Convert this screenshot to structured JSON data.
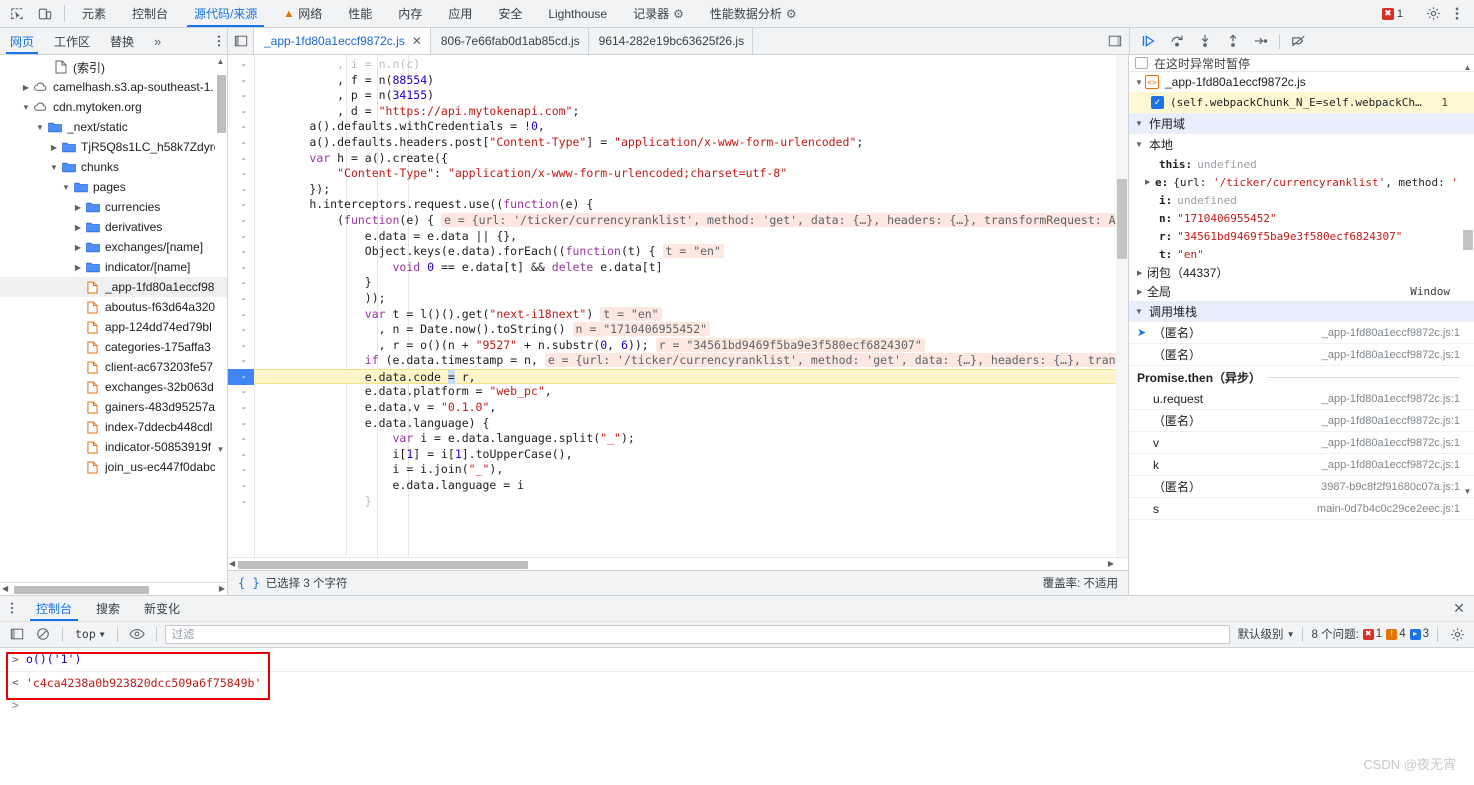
{
  "topbar": {
    "icons": [
      {
        "name": "inspect-element-icon"
      },
      {
        "name": "device-toolbar-icon"
      }
    ],
    "tabs": [
      {
        "label": "元素",
        "selected": false,
        "icon": null
      },
      {
        "label": "控制台",
        "selected": false,
        "icon": null
      },
      {
        "label": "源代码/来源",
        "selected": true,
        "icon": null
      },
      {
        "label": "网络",
        "selected": false,
        "icon": "warning-triangle-icon"
      },
      {
        "label": "性能",
        "selected": false,
        "icon": null
      },
      {
        "label": "内存",
        "selected": false,
        "icon": null
      },
      {
        "label": "应用",
        "selected": false,
        "icon": null
      },
      {
        "label": "安全",
        "selected": false,
        "icon": null
      },
      {
        "label": "Lighthouse",
        "selected": false,
        "icon": null
      },
      {
        "label": "记录器",
        "selected": false,
        "icon": "flask-icon"
      },
      {
        "label": "性能数据分析",
        "selected": false,
        "icon": "flask-icon"
      }
    ],
    "error_count": "1",
    "settings_label": "设置",
    "menu_label": "更多选项"
  },
  "subbar": {
    "nav_tabs": [
      {
        "label": "网页",
        "selected": true
      },
      {
        "label": "工作区",
        "selected": false
      },
      {
        "label": "替换",
        "selected": false
      },
      {
        "label": "»",
        "selected": false
      }
    ],
    "file_tabs": [
      {
        "label": "_app-1fd80a1eccf9872c.js",
        "selected": true,
        "closable": true
      },
      {
        "label": "806-7e66fab0d1ab85cd.js",
        "selected": false,
        "closable": false
      },
      {
        "label": "9614-282e19bc63625f26.js",
        "selected": false,
        "closable": false
      }
    ],
    "debug_buttons": [
      {
        "name": "resume-script-button",
        "title": "恢复脚本执行"
      },
      {
        "name": "step-over-button",
        "title": "跳过下一个函数调用"
      },
      {
        "name": "step-into-button",
        "title": "单步调试进入下一个函数调用"
      },
      {
        "name": "step-out-button",
        "title": "单步调试跳出当前函数"
      },
      {
        "name": "step-button",
        "title": "单步调试"
      },
      {
        "name": "deactivate-breakpoints-button",
        "title": "停用断点"
      }
    ]
  },
  "file_tree": [
    {
      "label": "(索引)",
      "indent": 2,
      "type": "doc",
      "arrow": "none",
      "selected": false
    },
    {
      "label": "camelhash.s3.ap-southeast-1.",
      "indent": 1,
      "type": "cloud",
      "arrow": "right",
      "selected": false
    },
    {
      "label": "cdn.mytoken.org",
      "indent": 1,
      "type": "cloud",
      "arrow": "down",
      "selected": false
    },
    {
      "label": "_next/static",
      "indent": 2,
      "type": "folder",
      "arrow": "down",
      "selected": false
    },
    {
      "label": "TjR5Q8s1LC_h58k7Zdyre",
      "indent": 3,
      "type": "folder",
      "arrow": "right",
      "selected": false
    },
    {
      "label": "chunks",
      "indent": 3,
      "type": "folder",
      "arrow": "down",
      "selected": false
    },
    {
      "label": "pages",
      "indent": 4,
      "type": "folder",
      "arrow": "down",
      "selected": false
    },
    {
      "label": "currencies",
      "indent": 5,
      "type": "folder",
      "arrow": "right",
      "selected": false
    },
    {
      "label": "derivatives",
      "indent": 5,
      "type": "folder",
      "arrow": "right",
      "selected": false
    },
    {
      "label": "exchanges/[name]",
      "indent": 5,
      "type": "folder",
      "arrow": "right",
      "selected": false
    },
    {
      "label": "indicator/[name]",
      "indent": 5,
      "type": "folder",
      "arrow": "right",
      "selected": false
    },
    {
      "label": "_app-1fd80a1eccf98",
      "indent": 6,
      "type": "js",
      "arrow": "none",
      "selected": true
    },
    {
      "label": "aboutus-f63d64a320",
      "indent": 6,
      "type": "js",
      "arrow": "none",
      "selected": false
    },
    {
      "label": "app-124dd74ed79bl",
      "indent": 6,
      "type": "js",
      "arrow": "none",
      "selected": false
    },
    {
      "label": "categories-175affa3",
      "indent": 6,
      "type": "js",
      "arrow": "none",
      "selected": false
    },
    {
      "label": "client-ac673203fe57",
      "indent": 6,
      "type": "js",
      "arrow": "none",
      "selected": false
    },
    {
      "label": "exchanges-32b063d",
      "indent": 6,
      "type": "js",
      "arrow": "none",
      "selected": false
    },
    {
      "label": "gainers-483d95257a",
      "indent": 6,
      "type": "js",
      "arrow": "none",
      "selected": false
    },
    {
      "label": "index-7ddecb448cdl",
      "indent": 6,
      "type": "js",
      "arrow": "none",
      "selected": false
    },
    {
      "label": "indicator-50853919f",
      "indent": 6,
      "type": "js",
      "arrow": "none",
      "selected": false
    },
    {
      "label": "join_us-ec447f0dabc",
      "indent": 6,
      "type": "js",
      "arrow": "none",
      "selected": false
    }
  ],
  "editor": {
    "lines": [
      {
        "gutter": "-",
        "text": "            , i = n.n(c)",
        "clipped": true
      },
      {
        "gutter": "-",
        "text": "            , f = n(88554)"
      },
      {
        "gutter": "-",
        "text": "            , p = n(34155)"
      },
      {
        "gutter": "-",
        "text": "            , d = \"https://api.mytokenapi.com\";"
      },
      {
        "gutter": "-",
        "text": "        a().defaults.withCredentials = !0,"
      },
      {
        "gutter": "-",
        "text": "        a().defaults.headers.post[\"Content-Type\"] = \"application/x-www-form-urlencoded\";"
      },
      {
        "gutter": "-",
        "text": "        var h = a().create({"
      },
      {
        "gutter": "-",
        "text": "            \"Content-Type\": \"application/x-www-form-urlencoded;charset=utf-8\""
      },
      {
        "gutter": "-",
        "text": "        });"
      },
      {
        "gutter": "-",
        "text": "        h.interceptors.request.use((function(e) {"
      },
      {
        "gutter": "-",
        "text": "            (function(e) {",
        "hint": "e = {url: '/ticker/currencyranklist', method: 'get', data: {…}, headers: {…}, transformRequest: A"
      },
      {
        "gutter": "-",
        "text": "                e.data = e.data || {},"
      },
      {
        "gutter": "-",
        "text": "                Object.keys(e.data).forEach((function(t) {",
        "hint": "t = \"en\""
      },
      {
        "gutter": "-",
        "text": "                    void 0 == e.data[t] && delete e.data[t]"
      },
      {
        "gutter": "-",
        "text": "                }"
      },
      {
        "gutter": "-",
        "text": "                ));"
      },
      {
        "gutter": "-",
        "text": "                var t = l()().get(\"next-i18next\")",
        "hint": "t = \"en\""
      },
      {
        "gutter": "-",
        "text": "                  , n = Date.now().toString()",
        "hint": "n = \"1710406955452\""
      },
      {
        "gutter": "-",
        "text": "                  , r = o()(n + \"9527\" + n.substr(0, 6));",
        "hint": "r = \"34561bd9469f5ba9e3f580ecf6824307\""
      },
      {
        "gutter": "-",
        "text": "                if (e.data.timestamp = n,",
        "hint": "e = {url: '/ticker/currencyranklist', method: 'get', data: {…}, headers: {…}, tran"
      },
      {
        "gutter": "-",
        "text": "                e.data.code = r,",
        "highlight": true,
        "selection": "="
      },
      {
        "gutter": "-",
        "text": "                e.data.platform = \"web_pc\","
      },
      {
        "gutter": "-",
        "text": "                e.data.v = \"0.1.0\","
      },
      {
        "gutter": "-",
        "text": "                e.data.language) {"
      },
      {
        "gutter": "-",
        "text": "                    var i = e.data.language.split(\"_\");"
      },
      {
        "gutter": "-",
        "text": "                    i[1] = i[1].toUpperCase(),"
      },
      {
        "gutter": "-",
        "text": "                    i = i.join(\"_\"),"
      },
      {
        "gutter": "-",
        "text": "                    e.data.language = i"
      },
      {
        "gutter": "-",
        "text": "                }"
      }
    ]
  },
  "status": {
    "format_label": "{ }",
    "selection_text": "已选择 3 个字符",
    "coverage_text": "覆盖率: 不适用"
  },
  "debugger": {
    "breakpoints_header": "在这时异常时暂停",
    "bp_file": "_app-1fd80a1eccf9872c.js",
    "bp_entry": "(self.webpackChunk_N_E=self.webpackCh…",
    "bp_line": "1",
    "scope_header": "作用域",
    "local_header": "本地",
    "locals": [
      {
        "name": "this:",
        "value": "undefined",
        "kind": "undefined",
        "expandable": false
      },
      {
        "name": "e:",
        "value": "{url: '/ticker/currencyranklist', method: '",
        "kind": "object",
        "expandable": true
      },
      {
        "name": "i:",
        "value": "undefined",
        "kind": "undefined",
        "expandable": false
      },
      {
        "name": "n:",
        "value": "\"1710406955452\"",
        "kind": "string",
        "expandable": false
      },
      {
        "name": "r:",
        "value": "\"34561bd9469f5ba9e3f580ecf6824307\"",
        "kind": "string",
        "expandable": false
      },
      {
        "name": "t:",
        "value": "\"en\"",
        "kind": "string",
        "expandable": false
      }
    ],
    "closure_label": "闭包（44337）",
    "global_label": "全局",
    "global_value": "Window",
    "callstack_header": "调用堆栈",
    "callstack": [
      {
        "name": "（匿名）",
        "location": "_app-1fd80a1eccf9872c.js:1",
        "active": true
      },
      {
        "name": "（匿名）",
        "location": "_app-1fd80a1eccf9872c.js:1",
        "active": false
      },
      {
        "name": "Promise.then（异步）",
        "location": "",
        "async": true
      },
      {
        "name": "u.request",
        "location": "_app-1fd80a1eccf9872c.js:1",
        "active": false
      },
      {
        "name": "（匿名）",
        "location": "_app-1fd80a1eccf9872c.js:1",
        "active": false
      },
      {
        "name": "v",
        "location": "_app-1fd80a1eccf9872c.js:1",
        "active": false
      },
      {
        "name": "k",
        "location": "_app-1fd80a1eccf9872c.js:1",
        "active": false
      },
      {
        "name": "（匿名）",
        "location": "3987-b9c8f2f91680c07a.js:1",
        "active": false
      },
      {
        "name": "s",
        "location": "main-0d7b4c0c29ce2eec.js:1",
        "active": false
      }
    ]
  },
  "drawer": {
    "tabs": [
      {
        "label": "控制台",
        "selected": true
      },
      {
        "label": "搜索",
        "selected": false
      },
      {
        "label": "新变化",
        "selected": false
      }
    ],
    "close_label": "✕",
    "toolbar": {
      "sidebar_toggle": "console-sidebar-icon",
      "clear_label": "clear-console-icon",
      "context_value": "top",
      "eye_label": "live-expression-icon",
      "filter_placeholder": "过滤",
      "level_label": "默认级别",
      "issues_label": "8 个问题:",
      "issue_errors": "1",
      "issue_warnings": "4",
      "issue_infos": "3",
      "settings_label": "console-settings-icon"
    },
    "entries": [
      {
        "type": "input",
        "marker": ">",
        "text": "o()('1')"
      },
      {
        "type": "output",
        "marker": "<",
        "text": "'c4ca4238a0b923820dcc509a6f75849b'"
      }
    ],
    "prompt_marker": ">"
  },
  "watermark": "CSDN @夜无宵"
}
